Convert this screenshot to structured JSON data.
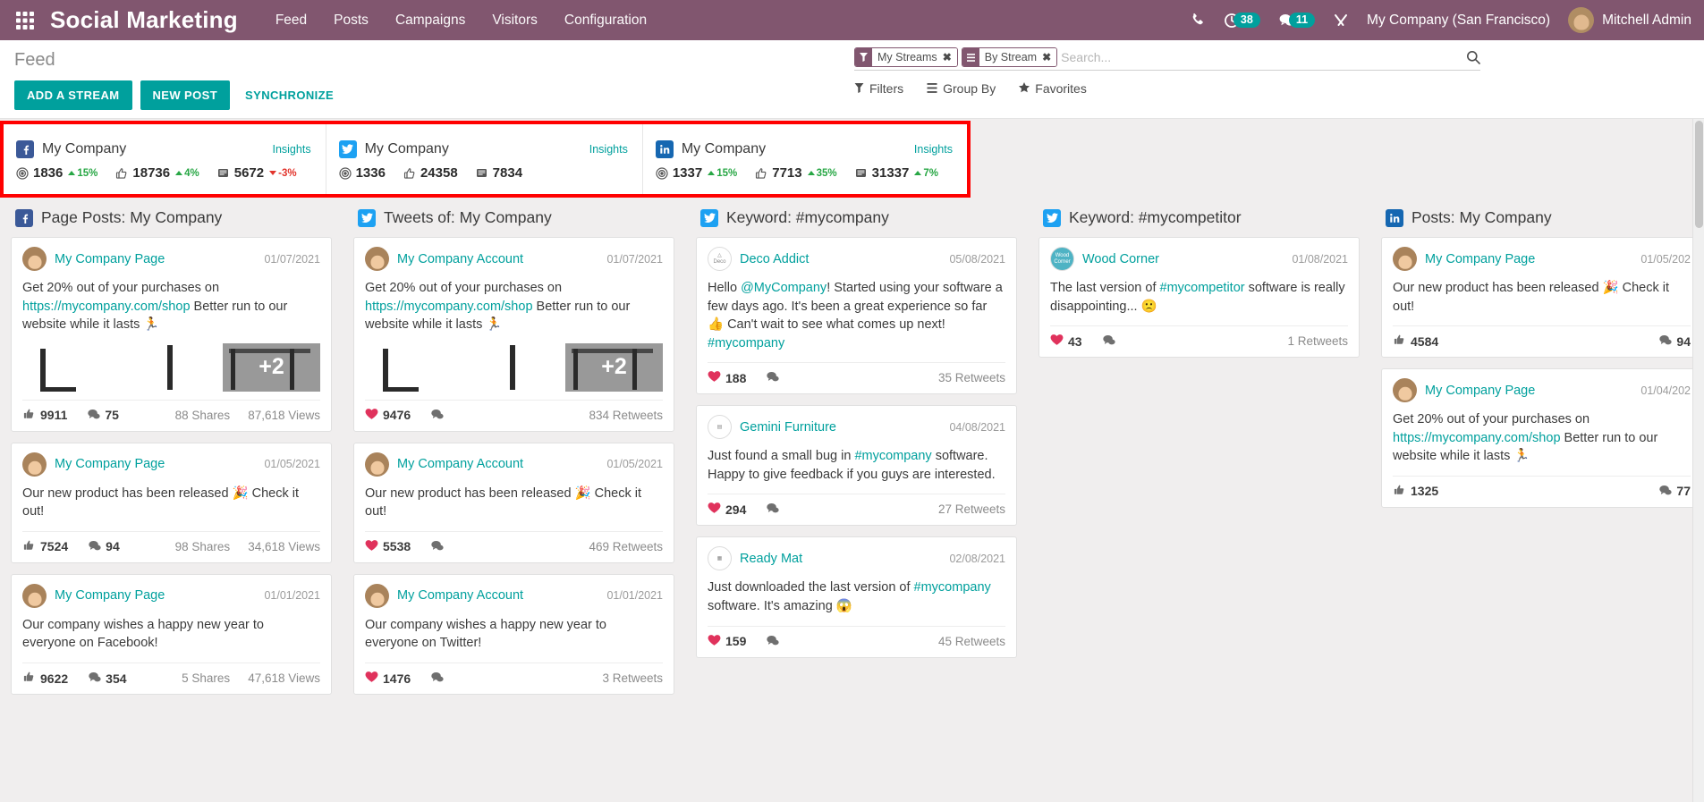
{
  "navbar": {
    "apps_icon": "apps-grid-icon",
    "brand": "Social Marketing",
    "menu": [
      {
        "label": "Feed"
      },
      {
        "label": "Posts"
      },
      {
        "label": "Campaigns"
      },
      {
        "label": "Visitors"
      },
      {
        "label": "Configuration"
      }
    ],
    "phone_icon": "phone-icon",
    "activity_icon": "clock-activity-icon",
    "activity_count": "38",
    "messaging_icon": "chat-bubble-icon",
    "messaging_count": "11",
    "tools_icon": "wrench-tools-icon",
    "company": "My Company (San Francisco)",
    "user": "Mitchell Admin",
    "avatar_icon": "user-avatar"
  },
  "control_panel": {
    "title": "Feed",
    "add_stream_label": "ADD A STREAM",
    "new_post_label": "NEW POST",
    "synchronize_label": "SYNCHRONIZE",
    "search": {
      "placeholder": "Search...",
      "value": "",
      "search_icon": "magnifier-icon",
      "facets": [
        {
          "icon": "filter-funnel-icon",
          "label": "My Streams",
          "remove": "✖"
        },
        {
          "icon": "group-by-lines-icon",
          "label": "By Stream",
          "remove": "✖"
        }
      ]
    },
    "filter_menus": [
      {
        "icon": "filter-funnel-icon",
        "label": "Filters"
      },
      {
        "icon": "group-by-lines-icon",
        "label": "Group By"
      },
      {
        "icon": "star-icon",
        "label": "Favorites"
      }
    ]
  },
  "insights": {
    "accounts": [
      {
        "network": "facebook",
        "icon": "facebook-icon",
        "name": "My Company",
        "insights_label": "Insights",
        "stats": [
          {
            "icon": "audience-target-icon",
            "value": "1836",
            "trend": "15%",
            "direction": "up"
          },
          {
            "icon": "thumbs-up-icon",
            "value": "18736",
            "trend": "4%",
            "direction": "up"
          },
          {
            "icon": "stories-icon",
            "value": "5672",
            "trend": "-3%",
            "direction": "down"
          }
        ]
      },
      {
        "network": "twitter",
        "icon": "twitter-icon",
        "name": "My Company",
        "insights_label": "Insights",
        "stats": [
          {
            "icon": "audience-target-icon",
            "value": "1336",
            "trend": "",
            "direction": "none"
          },
          {
            "icon": "thumbs-up-icon",
            "value": "24358",
            "trend": "",
            "direction": "none"
          },
          {
            "icon": "stories-icon",
            "value": "7834",
            "trend": "",
            "direction": "none"
          }
        ]
      },
      {
        "network": "linkedin",
        "icon": "linkedin-icon",
        "name": "My Company",
        "insights_label": "Insights",
        "stats": [
          {
            "icon": "audience-target-icon",
            "value": "1337",
            "trend": "15%",
            "direction": "up"
          },
          {
            "icon": "thumbs-up-icon",
            "value": "7713",
            "trend": "35%",
            "direction": "up"
          },
          {
            "icon": "stories-icon",
            "value": "31337",
            "trend": "7%",
            "direction": "up"
          }
        ]
      }
    ]
  },
  "streams": [
    {
      "icon": "facebook-icon",
      "network": "facebook",
      "title": "Page Posts: My Company",
      "posts": [
        {
          "author": "My Company Page",
          "avatar": "person-avatar",
          "date": "01/07/2021",
          "body_parts": [
            {
              "type": "text",
              "text": "Get 20% out of your purchases on "
            },
            {
              "type": "link",
              "text": "https://mycompany.com/shop"
            },
            {
              "type": "text",
              "text": " Better run to our website while it lasts 🏃"
            }
          ],
          "images": [
            "chair",
            "post",
            "table"
          ],
          "image_more": "+2",
          "footer": [
            {
              "icon": "thumbs-up-icon",
              "value": "9911"
            },
            {
              "icon": "comment-icon",
              "value": "75"
            }
          ],
          "footer_right": [
            "88 Shares",
            "87,618 Views"
          ]
        },
        {
          "author": "My Company Page",
          "avatar": "person-avatar",
          "date": "01/05/2021",
          "body_parts": [
            {
              "type": "text",
              "text": "Our new product has been released 🎉 Check it out!"
            }
          ],
          "images": [],
          "footer": [
            {
              "icon": "thumbs-up-icon",
              "value": "7524"
            },
            {
              "icon": "comment-icon",
              "value": "94"
            }
          ],
          "footer_right": [
            "98 Shares",
            "34,618 Views"
          ]
        },
        {
          "author": "My Company Page",
          "avatar": "person-avatar",
          "date": "01/01/2021",
          "body_parts": [
            {
              "type": "text",
              "text": "Our company wishes a happy new year to everyone on Facebook!"
            }
          ],
          "images": [],
          "footer": [
            {
              "icon": "thumbs-up-icon",
              "value": "9622"
            },
            {
              "icon": "comment-icon",
              "value": "354"
            }
          ],
          "footer_right": [
            "5 Shares",
            "47,618 Views"
          ]
        }
      ]
    },
    {
      "icon": "twitter-icon",
      "network": "twitter",
      "title": "Tweets of: My Company",
      "posts": [
        {
          "author": "My Company Account",
          "avatar": "person-avatar",
          "date": "01/07/2021",
          "body_parts": [
            {
              "type": "text",
              "text": "Get 20% out of your purchases on "
            },
            {
              "type": "link",
              "text": "https://mycompany.com/shop"
            },
            {
              "type": "text",
              "text": " Better run to our website while it lasts 🏃"
            }
          ],
          "images": [
            "chair",
            "post",
            "table"
          ],
          "image_more": "+2",
          "footer": [
            {
              "icon": "heart-icon",
              "value": "9476"
            },
            {
              "icon": "comment-icon",
              "value": ""
            }
          ],
          "footer_right": [
            "834 Retweets"
          ]
        },
        {
          "author": "My Company Account",
          "avatar": "person-avatar",
          "date": "01/05/2021",
          "body_parts": [
            {
              "type": "text",
              "text": "Our new product has been released 🎉 Check it out!"
            }
          ],
          "images": [],
          "footer": [
            {
              "icon": "heart-icon",
              "value": "5538"
            },
            {
              "icon": "comment-icon",
              "value": ""
            }
          ],
          "footer_right": [
            "469 Retweets"
          ]
        },
        {
          "author": "My Company Account",
          "avatar": "person-avatar",
          "date": "01/01/2021",
          "body_parts": [
            {
              "type": "text",
              "text": "Our company wishes a happy new year to everyone on Twitter!"
            }
          ],
          "images": [],
          "footer": [
            {
              "icon": "heart-icon",
              "value": "1476"
            },
            {
              "icon": "comment-icon",
              "value": ""
            }
          ],
          "footer_right": [
            "3 Retweets"
          ]
        }
      ]
    },
    {
      "icon": "twitter-icon",
      "network": "twitter",
      "title": "Keyword: #mycompany",
      "posts": [
        {
          "author": "Deco Addict",
          "avatar": "deco-addict-logo",
          "date": "05/08/2021",
          "body_parts": [
            {
              "type": "text",
              "text": "Hello "
            },
            {
              "type": "link",
              "text": "@MyCompany"
            },
            {
              "type": "text",
              "text": "! Started using your software a few days ago. It's been a great experience so far 👍 Can't wait to see what comes up next! "
            },
            {
              "type": "link",
              "text": "#mycompany"
            }
          ],
          "images": [],
          "footer": [
            {
              "icon": "heart-icon",
              "value": "188"
            },
            {
              "icon": "comment-icon",
              "value": ""
            }
          ],
          "footer_right": [
            "35 Retweets"
          ]
        },
        {
          "author": "Gemini Furniture",
          "avatar": "gemini-furniture-logo",
          "date": "04/08/2021",
          "body_parts": [
            {
              "type": "text",
              "text": "Just found a small bug in "
            },
            {
              "type": "link",
              "text": "#mycompany"
            },
            {
              "type": "text",
              "text": " software. Happy to give feedback if you guys are interested."
            }
          ],
          "images": [],
          "footer": [
            {
              "icon": "heart-icon",
              "value": "294"
            },
            {
              "icon": "comment-icon",
              "value": ""
            }
          ],
          "footer_right": [
            "27 Retweets"
          ]
        },
        {
          "author": "Ready Mat",
          "avatar": "ready-mat-logo",
          "date": "02/08/2021",
          "body_parts": [
            {
              "type": "link",
              "text": "#mycompany"
            },
            {
              "type": "text",
              "text": " software. It's amazing 😱"
            }
          ],
          "body_prefix": "Just downloaded the last version of ",
          "images": [],
          "footer": [
            {
              "icon": "heart-icon",
              "value": "159"
            },
            {
              "icon": "comment-icon",
              "value": ""
            }
          ],
          "footer_right": [
            "45 Retweets"
          ]
        }
      ]
    },
    {
      "icon": "twitter-icon",
      "network": "twitter",
      "title": "Keyword: #mycompetitor",
      "posts": [
        {
          "author": "Wood Corner",
          "avatar": "wood-corner-logo",
          "date": "01/08/2021",
          "body_parts": [
            {
              "type": "text",
              "text": "The last version of "
            },
            {
              "type": "link",
              "text": "#mycompetitor"
            },
            {
              "type": "text",
              "text": " software is really disappointing... 🙁"
            }
          ],
          "images": [],
          "footer": [
            {
              "icon": "heart-icon",
              "value": "43"
            },
            {
              "icon": "comment-icon",
              "value": ""
            }
          ],
          "footer_right": [
            "1 Retweets"
          ]
        }
      ]
    },
    {
      "icon": "linkedin-icon",
      "network": "linkedin",
      "title": "Posts: My Company",
      "posts": [
        {
          "author": "My Company Page",
          "avatar": "person-avatar",
          "date": "01/05/202",
          "body_parts": [
            {
              "type": "text",
              "text": "Our new product has been released 🎉 Check it out!"
            }
          ],
          "images": [],
          "footer": [
            {
              "icon": "thumbs-up-icon",
              "value": "4584"
            }
          ],
          "footer_right": [
            "94"
          ]
        },
        {
          "author": "My Company Page",
          "avatar": "person-avatar",
          "date": "01/04/202",
          "body_parts": [
            {
              "type": "text",
              "text": "Get 20% out of your purchases on "
            },
            {
              "type": "link",
              "text": "https://mycompany.com/shop"
            },
            {
              "type": "text",
              "text": " Better run to our website while it lasts 🏃"
            }
          ],
          "images": [],
          "footer": [
            {
              "icon": "thumbs-up-icon",
              "value": "1325"
            }
          ],
          "footer_right": [
            "77"
          ]
        }
      ]
    }
  ],
  "colors": {
    "navbar": "#81566f",
    "accent": "#00a09d",
    "highlight_box": "#ff0000",
    "facebook": "#3b5998",
    "twitter": "#1da1f2",
    "linkedin": "#1667b1",
    "trend_up": "#28a745",
    "trend_down": "#e2342c"
  }
}
